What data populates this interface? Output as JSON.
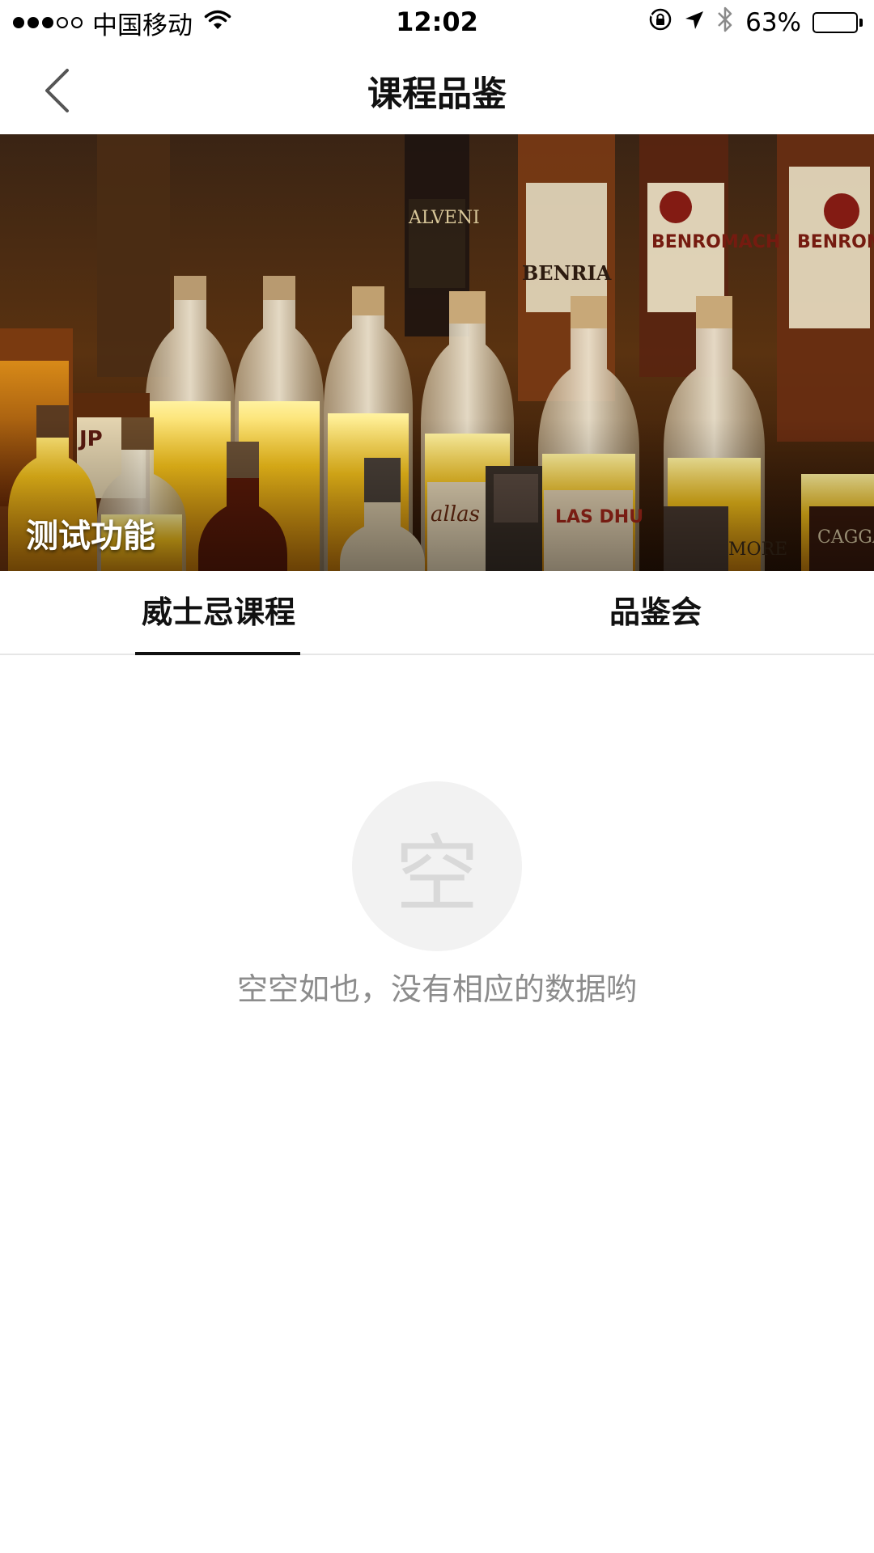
{
  "status_bar": {
    "carrier": "中国移动",
    "time": "12:02",
    "battery_percent_text": "63%",
    "battery_level": 0.63,
    "signal_bars_filled": 3,
    "signal_bars_total": 5,
    "icons": [
      "wifi-icon",
      "orientation-lock-icon",
      "location-arrow-icon",
      "bluetooth-icon",
      "battery-icon"
    ]
  },
  "nav": {
    "title": "课程品鉴",
    "back_icon": "chevron-left-icon"
  },
  "banner": {
    "caption": "测试功能"
  },
  "tabs": [
    {
      "label": "威士忌课程",
      "active": true
    },
    {
      "label": "品鉴会",
      "active": false
    }
  ],
  "empty_state": {
    "icon_char": "空",
    "message": "空空如也，没有相应的数据哟"
  },
  "colors": {
    "text_primary": "#111111",
    "text_muted": "#8c8c8c",
    "divider": "#e6e6e6",
    "empty_circle": "#f2f2f2"
  }
}
